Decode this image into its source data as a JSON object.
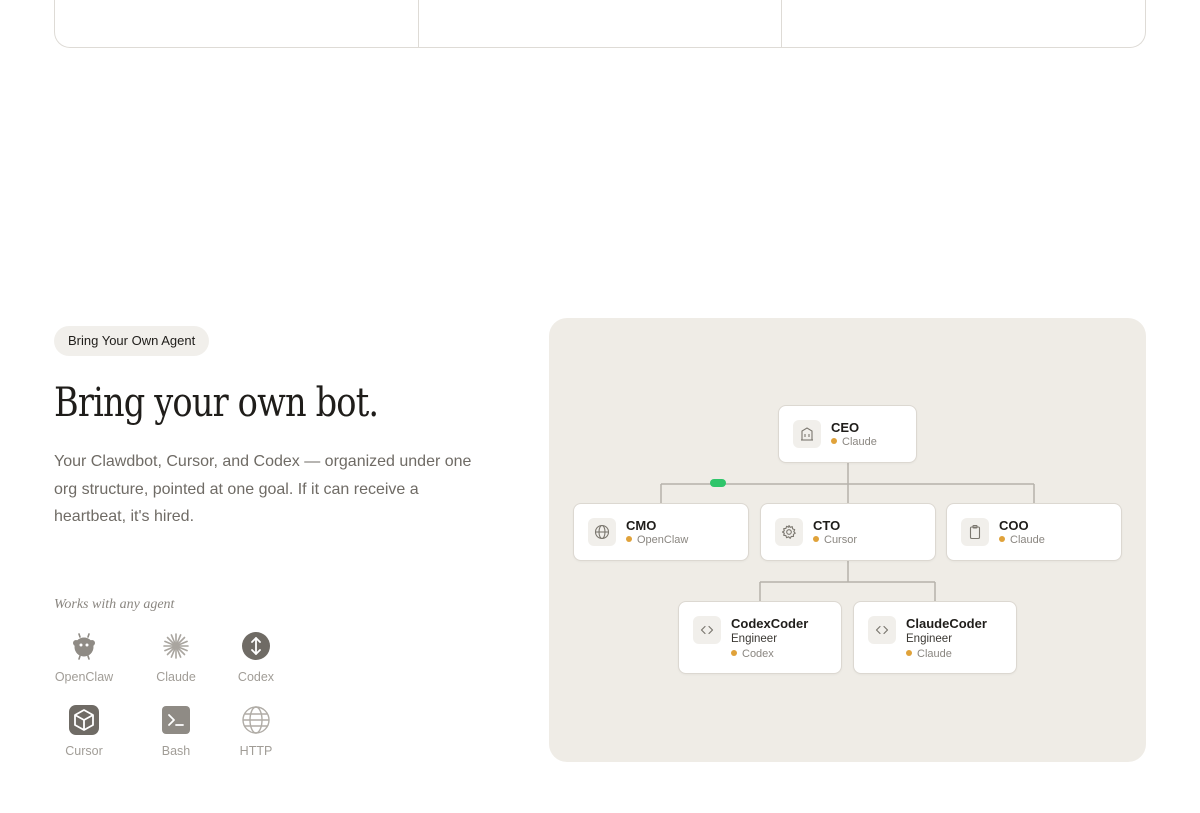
{
  "section": {
    "badge": "Bring Your Own Agent",
    "headline": "Bring your own bot.",
    "subtext": "Your Clawdbot, Cursor, and Codex — organized under one org structure, pointed at one goal. If it can receive a heartbeat, it's hired.",
    "works_label": "Works with any agent"
  },
  "agents": [
    {
      "label": "OpenClaw",
      "icon": "openclaw-icon"
    },
    {
      "label": "Claude",
      "icon": "claude-icon"
    },
    {
      "label": "Codex",
      "icon": "codex-icon"
    },
    {
      "label": "Cursor",
      "icon": "cursor-icon"
    },
    {
      "label": "Bash",
      "icon": "bash-icon"
    },
    {
      "label": "HTTP",
      "icon": "globe-icon"
    }
  ],
  "org_chart": {
    "nodes": {
      "ceo": {
        "title": "CEO",
        "tool": "Claude",
        "icon": "building-icon"
      },
      "cmo": {
        "title": "CMO",
        "tool": "OpenClaw",
        "icon": "globe-icon"
      },
      "cto": {
        "title": "CTO",
        "tool": "Cursor",
        "icon": "gear-icon"
      },
      "coo": {
        "title": "COO",
        "tool": "Claude",
        "icon": "clipboard-icon"
      },
      "codexcoder": {
        "title": "CodexCoder",
        "role": "Engineer",
        "tool": "Codex",
        "icon": "code-icon"
      },
      "claudecoder": {
        "title": "ClaudeCoder",
        "role": "Engineer",
        "tool": "Claude",
        "icon": "code-icon"
      }
    }
  },
  "colors": {
    "status_dot": "#e0a23a",
    "pulse": "#2fc56a",
    "panel_bg": "#efece6",
    "connector": "#b5b1aa"
  }
}
